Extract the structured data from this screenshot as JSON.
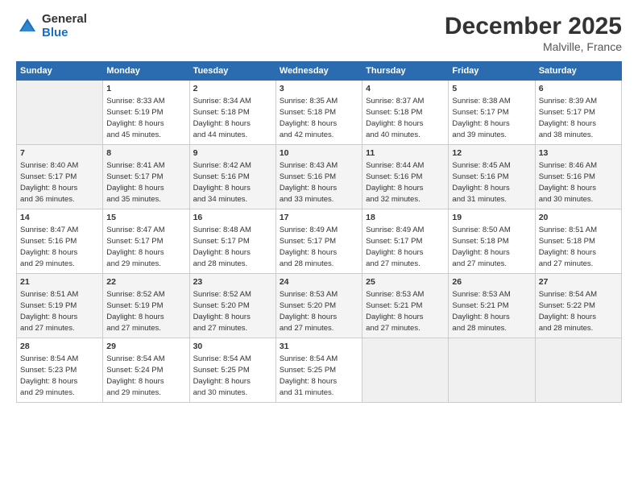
{
  "logo": {
    "general": "General",
    "blue": "Blue"
  },
  "header": {
    "title": "December 2025",
    "subtitle": "Malville, France"
  },
  "columns": [
    "Sunday",
    "Monday",
    "Tuesday",
    "Wednesday",
    "Thursday",
    "Friday",
    "Saturday"
  ],
  "weeks": [
    [
      {
        "day": "",
        "info": ""
      },
      {
        "day": "1",
        "info": "Sunrise: 8:33 AM\nSunset: 5:19 PM\nDaylight: 8 hours\nand 45 minutes."
      },
      {
        "day": "2",
        "info": "Sunrise: 8:34 AM\nSunset: 5:18 PM\nDaylight: 8 hours\nand 44 minutes."
      },
      {
        "day": "3",
        "info": "Sunrise: 8:35 AM\nSunset: 5:18 PM\nDaylight: 8 hours\nand 42 minutes."
      },
      {
        "day": "4",
        "info": "Sunrise: 8:37 AM\nSunset: 5:18 PM\nDaylight: 8 hours\nand 40 minutes."
      },
      {
        "day": "5",
        "info": "Sunrise: 8:38 AM\nSunset: 5:17 PM\nDaylight: 8 hours\nand 39 minutes."
      },
      {
        "day": "6",
        "info": "Sunrise: 8:39 AM\nSunset: 5:17 PM\nDaylight: 8 hours\nand 38 minutes."
      }
    ],
    [
      {
        "day": "7",
        "info": "Sunrise: 8:40 AM\nSunset: 5:17 PM\nDaylight: 8 hours\nand 36 minutes."
      },
      {
        "day": "8",
        "info": "Sunrise: 8:41 AM\nSunset: 5:17 PM\nDaylight: 8 hours\nand 35 minutes."
      },
      {
        "day": "9",
        "info": "Sunrise: 8:42 AM\nSunset: 5:16 PM\nDaylight: 8 hours\nand 34 minutes."
      },
      {
        "day": "10",
        "info": "Sunrise: 8:43 AM\nSunset: 5:16 PM\nDaylight: 8 hours\nand 33 minutes."
      },
      {
        "day": "11",
        "info": "Sunrise: 8:44 AM\nSunset: 5:16 PM\nDaylight: 8 hours\nand 32 minutes."
      },
      {
        "day": "12",
        "info": "Sunrise: 8:45 AM\nSunset: 5:16 PM\nDaylight: 8 hours\nand 31 minutes."
      },
      {
        "day": "13",
        "info": "Sunrise: 8:46 AM\nSunset: 5:16 PM\nDaylight: 8 hours\nand 30 minutes."
      }
    ],
    [
      {
        "day": "14",
        "info": "Sunrise: 8:47 AM\nSunset: 5:16 PM\nDaylight: 8 hours\nand 29 minutes."
      },
      {
        "day": "15",
        "info": "Sunrise: 8:47 AM\nSunset: 5:17 PM\nDaylight: 8 hours\nand 29 minutes."
      },
      {
        "day": "16",
        "info": "Sunrise: 8:48 AM\nSunset: 5:17 PM\nDaylight: 8 hours\nand 28 minutes."
      },
      {
        "day": "17",
        "info": "Sunrise: 8:49 AM\nSunset: 5:17 PM\nDaylight: 8 hours\nand 28 minutes."
      },
      {
        "day": "18",
        "info": "Sunrise: 8:49 AM\nSunset: 5:17 PM\nDaylight: 8 hours\nand 27 minutes."
      },
      {
        "day": "19",
        "info": "Sunrise: 8:50 AM\nSunset: 5:18 PM\nDaylight: 8 hours\nand 27 minutes."
      },
      {
        "day": "20",
        "info": "Sunrise: 8:51 AM\nSunset: 5:18 PM\nDaylight: 8 hours\nand 27 minutes."
      }
    ],
    [
      {
        "day": "21",
        "info": "Sunrise: 8:51 AM\nSunset: 5:19 PM\nDaylight: 8 hours\nand 27 minutes."
      },
      {
        "day": "22",
        "info": "Sunrise: 8:52 AM\nSunset: 5:19 PM\nDaylight: 8 hours\nand 27 minutes."
      },
      {
        "day": "23",
        "info": "Sunrise: 8:52 AM\nSunset: 5:20 PM\nDaylight: 8 hours\nand 27 minutes."
      },
      {
        "day": "24",
        "info": "Sunrise: 8:53 AM\nSunset: 5:20 PM\nDaylight: 8 hours\nand 27 minutes."
      },
      {
        "day": "25",
        "info": "Sunrise: 8:53 AM\nSunset: 5:21 PM\nDaylight: 8 hours\nand 27 minutes."
      },
      {
        "day": "26",
        "info": "Sunrise: 8:53 AM\nSunset: 5:21 PM\nDaylight: 8 hours\nand 28 minutes."
      },
      {
        "day": "27",
        "info": "Sunrise: 8:54 AM\nSunset: 5:22 PM\nDaylight: 8 hours\nand 28 minutes."
      }
    ],
    [
      {
        "day": "28",
        "info": "Sunrise: 8:54 AM\nSunset: 5:23 PM\nDaylight: 8 hours\nand 29 minutes."
      },
      {
        "day": "29",
        "info": "Sunrise: 8:54 AM\nSunset: 5:24 PM\nDaylight: 8 hours\nand 29 minutes."
      },
      {
        "day": "30",
        "info": "Sunrise: 8:54 AM\nSunset: 5:25 PM\nDaylight: 8 hours\nand 30 minutes."
      },
      {
        "day": "31",
        "info": "Sunrise: 8:54 AM\nSunset: 5:25 PM\nDaylight: 8 hours\nand 31 minutes."
      },
      {
        "day": "",
        "info": ""
      },
      {
        "day": "",
        "info": ""
      },
      {
        "day": "",
        "info": ""
      }
    ]
  ]
}
